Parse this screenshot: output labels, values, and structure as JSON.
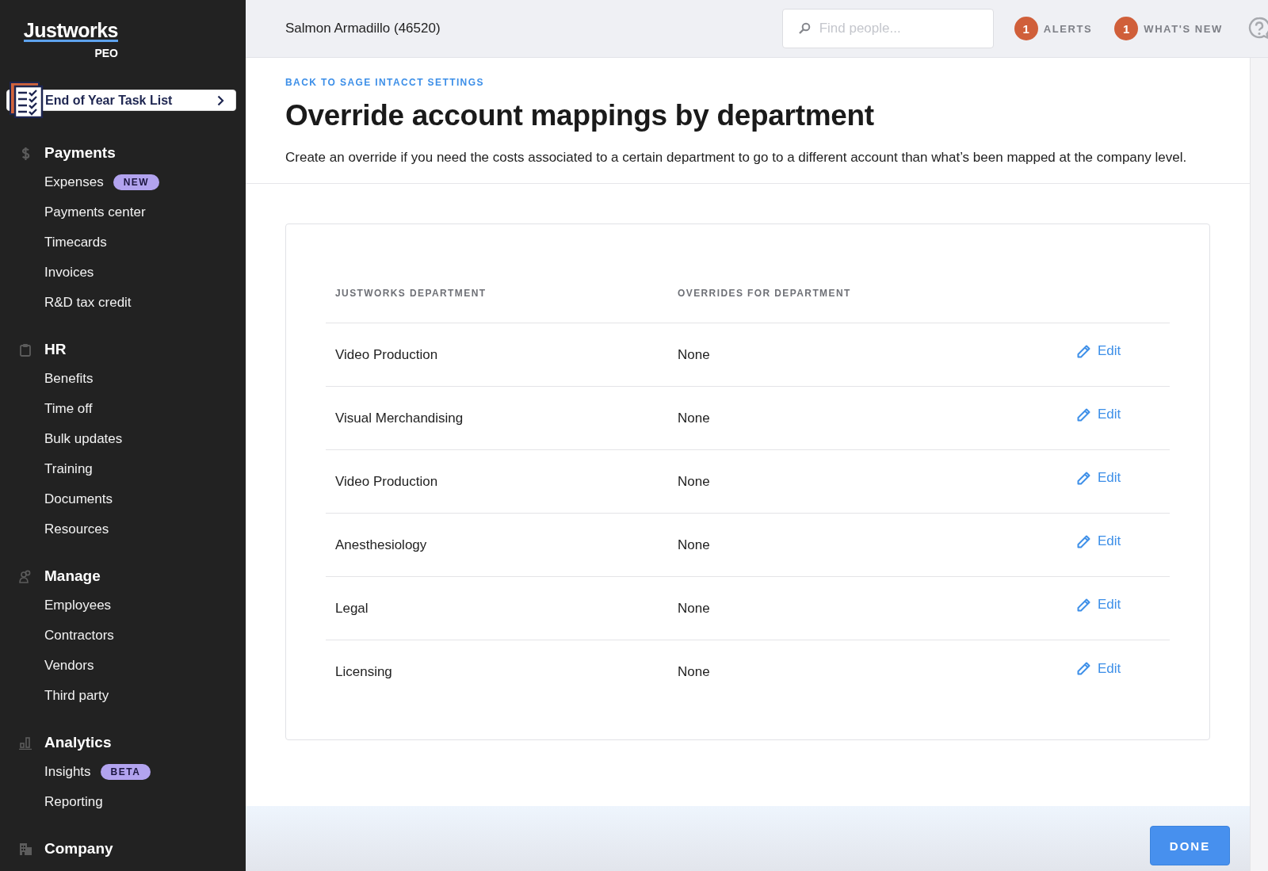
{
  "sidebar": {
    "logo": "Justworks",
    "logo_sub": "PEO",
    "task_list": "End of Year Task List",
    "sections": [
      {
        "kind": "payments",
        "title": "Payments",
        "items": [
          {
            "label": "Expenses",
            "badge": "NEW"
          },
          {
            "label": "Payments center"
          },
          {
            "label": "Timecards"
          },
          {
            "label": "Invoices"
          },
          {
            "label": "R&D tax credit"
          }
        ]
      },
      {
        "kind": "hr",
        "title": "HR",
        "items": [
          {
            "label": "Benefits"
          },
          {
            "label": "Time off"
          },
          {
            "label": "Bulk updates"
          },
          {
            "label": "Training"
          },
          {
            "label": "Documents"
          },
          {
            "label": "Resources"
          }
        ]
      },
      {
        "kind": "manage",
        "title": "Manage",
        "items": [
          {
            "label": "Employees"
          },
          {
            "label": "Contractors"
          },
          {
            "label": "Vendors"
          },
          {
            "label": "Third party"
          }
        ]
      },
      {
        "kind": "analytics",
        "title": "Analytics",
        "items": [
          {
            "label": "Insights",
            "badge": "BETA"
          },
          {
            "label": "Reporting"
          }
        ]
      },
      {
        "kind": "company",
        "title": "Company"
      }
    ]
  },
  "header": {
    "company": "Salmon Armadillo (46520)",
    "search": {
      "placeholder": "Find people..."
    },
    "notices": [
      {
        "count": "1",
        "label": "ALERTS"
      },
      {
        "count": "1",
        "label": "WHAT'S NEW"
      }
    ]
  },
  "page": {
    "back_link": "BACK TO SAGE INTACCT SETTINGS",
    "title": "Override account mappings by department",
    "description": "Create an override if you need the costs associated to a certain department to go to a different account than what’s been mapped at the company level.",
    "table": {
      "columns": [
        "JUSTWORKS DEPARTMENT",
        "OVERRIDES FOR DEPARTMENT"
      ],
      "rows": [
        {
          "department": "Video Production",
          "overrides": "None",
          "action": "Edit"
        },
        {
          "department": "Visual Merchandising",
          "overrides": "None",
          "action": "Edit"
        },
        {
          "department": "Video Production",
          "overrides": "None",
          "action": "Edit"
        },
        {
          "department": "Anesthesiology",
          "overrides": "None",
          "action": "Edit"
        },
        {
          "department": "Legal",
          "overrides": "None",
          "action": "Edit"
        },
        {
          "department": "Licensing",
          "overrides": "None",
          "action": "Edit"
        }
      ]
    },
    "done_button": "DONE"
  }
}
